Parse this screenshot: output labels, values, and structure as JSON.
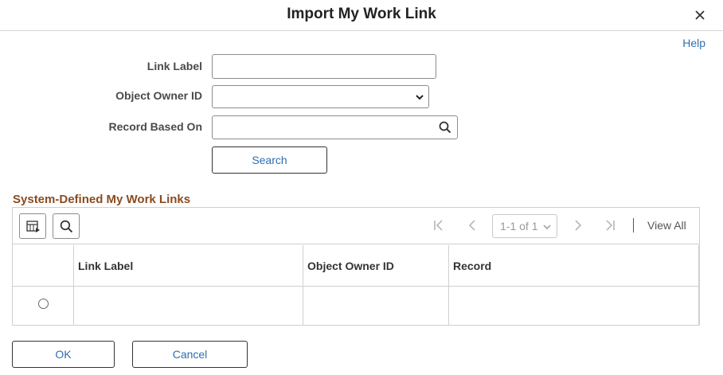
{
  "dialog": {
    "title": "Import My Work Link",
    "help_label": "Help"
  },
  "form": {
    "link_label": {
      "label": "Link Label",
      "value": ""
    },
    "object_owner_id": {
      "label": "Object Owner ID",
      "selected": ""
    },
    "record_based_on": {
      "label": "Record Based On",
      "value": ""
    },
    "search_button": "Search"
  },
  "grid": {
    "section_title": "System-Defined My Work Links",
    "pager": {
      "range": "1-1 of 1",
      "view_all": "View All"
    },
    "columns": [
      "Link Label",
      "Object Owner ID",
      "Record"
    ],
    "rows": [
      {
        "link_label": "",
        "object_owner_id": "",
        "record": ""
      }
    ]
  },
  "footer": {
    "ok_label": "OK",
    "cancel_label": "Cancel"
  },
  "icons": {
    "close": "close-icon",
    "lookup": "search-icon",
    "personalize": "grid-personalize-icon",
    "find": "search-icon",
    "first": "first-page-icon",
    "prev": "previous-page-icon",
    "next": "next-page-icon",
    "last": "last-page-icon"
  },
  "colors": {
    "link": "#2f6fb0",
    "section_title": "#8a4b1e",
    "border": "#8c8c8c"
  }
}
